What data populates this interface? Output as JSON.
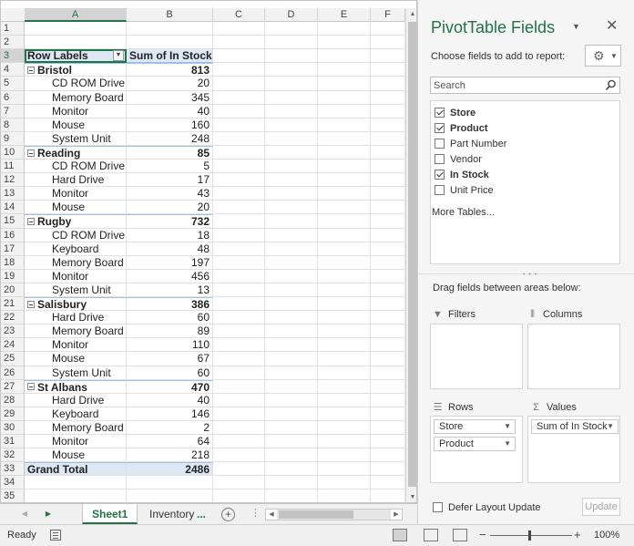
{
  "sheet": {
    "columns": [
      "A",
      "B",
      "C",
      "D",
      "E",
      "F"
    ],
    "rows": [
      {
        "n": "1",
        "a": "",
        "b": "",
        "kind": "empty"
      },
      {
        "n": "2",
        "a": "",
        "b": "",
        "kind": "empty"
      },
      {
        "n": "3",
        "a": "Row Labels",
        "b": "Sum of In Stock",
        "kind": "header"
      },
      {
        "n": "4",
        "a": "Bristol",
        "b": "813",
        "kind": "group"
      },
      {
        "n": "5",
        "a": "CD ROM Drive",
        "b": "20",
        "kind": "item"
      },
      {
        "n": "6",
        "a": "Memory Board",
        "b": "345",
        "kind": "item"
      },
      {
        "n": "7",
        "a": "Monitor",
        "b": "40",
        "kind": "item"
      },
      {
        "n": "8",
        "a": "Mouse",
        "b": "160",
        "kind": "item"
      },
      {
        "n": "9",
        "a": "System Unit",
        "b": "248",
        "kind": "item"
      },
      {
        "n": "10",
        "a": "Reading",
        "b": "85",
        "kind": "group"
      },
      {
        "n": "11",
        "a": "CD ROM Drive",
        "b": "5",
        "kind": "item"
      },
      {
        "n": "12",
        "a": "Hard Drive",
        "b": "17",
        "kind": "item"
      },
      {
        "n": "13",
        "a": "Monitor",
        "b": "43",
        "kind": "item"
      },
      {
        "n": "14",
        "a": "Mouse",
        "b": "20",
        "kind": "item"
      },
      {
        "n": "15",
        "a": "Rugby",
        "b": "732",
        "kind": "group"
      },
      {
        "n": "16",
        "a": "CD ROM Drive",
        "b": "18",
        "kind": "item"
      },
      {
        "n": "17",
        "a": "Keyboard",
        "b": "48",
        "kind": "item"
      },
      {
        "n": "18",
        "a": "Memory Board",
        "b": "197",
        "kind": "item"
      },
      {
        "n": "19",
        "a": "Monitor",
        "b": "456",
        "kind": "item"
      },
      {
        "n": "20",
        "a": "System Unit",
        "b": "13",
        "kind": "item"
      },
      {
        "n": "21",
        "a": "Salisbury",
        "b": "386",
        "kind": "group"
      },
      {
        "n": "22",
        "a": "Hard Drive",
        "b": "60",
        "kind": "item"
      },
      {
        "n": "23",
        "a": "Memory Board",
        "b": "89",
        "kind": "item"
      },
      {
        "n": "24",
        "a": "Monitor",
        "b": "110",
        "kind": "item"
      },
      {
        "n": "25",
        "a": "Mouse",
        "b": "67",
        "kind": "item"
      },
      {
        "n": "26",
        "a": "System Unit",
        "b": "60",
        "kind": "item"
      },
      {
        "n": "27",
        "a": "St Albans",
        "b": "470",
        "kind": "group"
      },
      {
        "n": "28",
        "a": "Hard Drive",
        "b": "40",
        "kind": "item"
      },
      {
        "n": "29",
        "a": "Keyboard",
        "b": "146",
        "kind": "item"
      },
      {
        "n": "30",
        "a": "Memory Board",
        "b": "2",
        "kind": "item"
      },
      {
        "n": "31",
        "a": "Monitor",
        "b": "64",
        "kind": "item"
      },
      {
        "n": "32",
        "a": "Mouse",
        "b": "218",
        "kind": "item"
      },
      {
        "n": "33",
        "a": "Grand Total",
        "b": "2486",
        "kind": "grand"
      },
      {
        "n": "34",
        "a": "",
        "b": "",
        "kind": "empty"
      },
      {
        "n": "35",
        "a": "",
        "b": "",
        "kind": "empty"
      }
    ]
  },
  "tabs": {
    "sheets": [
      "Sheet1",
      "Inventory"
    ],
    "more": "...",
    "add": "+",
    "dots": "⋮"
  },
  "status": {
    "ready": "Ready",
    "zoom": "100%",
    "minus": "−",
    "plus": "+"
  },
  "pane": {
    "title": "PivotTable Fields",
    "choose_label": "Choose fields to add to report:",
    "search_placeholder": "Search",
    "fields": [
      {
        "label": "Store",
        "checked": true
      },
      {
        "label": "Product",
        "checked": true
      },
      {
        "label": "Part Number",
        "checked": false
      },
      {
        "label": "Vendor",
        "checked": false
      },
      {
        "label": "In Stock",
        "checked": true
      },
      {
        "label": "Unit Price",
        "checked": false
      }
    ],
    "more_tables": "More Tables...",
    "drag_label": "Drag fields between areas below:",
    "areas": {
      "filters": "Filters",
      "columns": "Columns",
      "rows": "Rows",
      "values": "Values"
    },
    "rows_chips": [
      "Store",
      "Product"
    ],
    "values_chips": [
      "Sum of In Stock"
    ],
    "defer_label": "Defer Layout Update",
    "update_label": "Update"
  },
  "colors": {
    "accent": "#217346",
    "pivot_header_bg": "#dde8f4",
    "pivot_line": "#9bc2e6"
  }
}
